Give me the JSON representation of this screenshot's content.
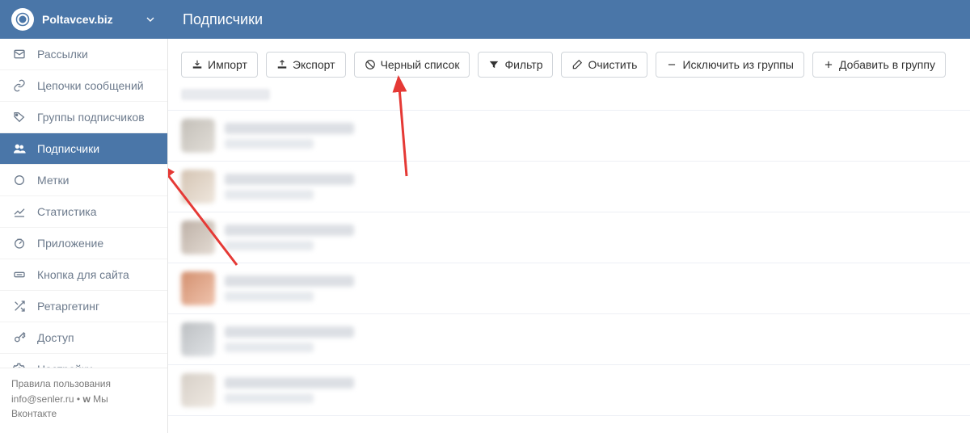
{
  "account": {
    "name": "Poltavcev.biz"
  },
  "page": {
    "title": "Подписчики"
  },
  "sidebar": {
    "items": [
      {
        "icon": "envelope-icon",
        "label": "Рассылки",
        "active": false
      },
      {
        "icon": "link-icon",
        "label": "Цепочки сообщений",
        "active": false
      },
      {
        "icon": "tags-icon",
        "label": "Группы подписчиков",
        "active": false
      },
      {
        "icon": "users-icon",
        "label": "Подписчики",
        "active": true
      },
      {
        "icon": "circle-icon",
        "label": "Метки",
        "active": false
      },
      {
        "icon": "chart-icon",
        "label": "Статистика",
        "active": false
      },
      {
        "icon": "dashboard-icon",
        "label": "Приложение",
        "active": false
      },
      {
        "icon": "button-icon",
        "label": "Кнопка для сайта",
        "active": false
      },
      {
        "icon": "shuffle-icon",
        "label": "Ретаргетинг",
        "active": false
      },
      {
        "icon": "key-icon",
        "label": "Доступ",
        "active": false
      },
      {
        "icon": "gear-icon",
        "label": "Настройки",
        "active": false
      }
    ]
  },
  "toolbar": {
    "import_label": "Импорт",
    "export_label": "Экспорт",
    "blacklist_label": "Черный список",
    "filter_label": "Фильтр",
    "clear_label": "Очистить",
    "exclude_label": "Исключить из группы",
    "add_label": "Добавить в группу"
  },
  "footer": {
    "rules": "Правила пользования",
    "email": "info@senler.ru",
    "separator": " • ",
    "vk_prefix": "Мы Вконтакте"
  },
  "list": {
    "rows": [
      {
        "avatar_class": "av1"
      },
      {
        "avatar_class": "av2"
      },
      {
        "avatar_class": "av3"
      },
      {
        "avatar_class": "av4"
      },
      {
        "avatar_class": "av5"
      },
      {
        "avatar_class": "av6"
      }
    ]
  },
  "colors": {
    "brand": "#4a76a8"
  }
}
